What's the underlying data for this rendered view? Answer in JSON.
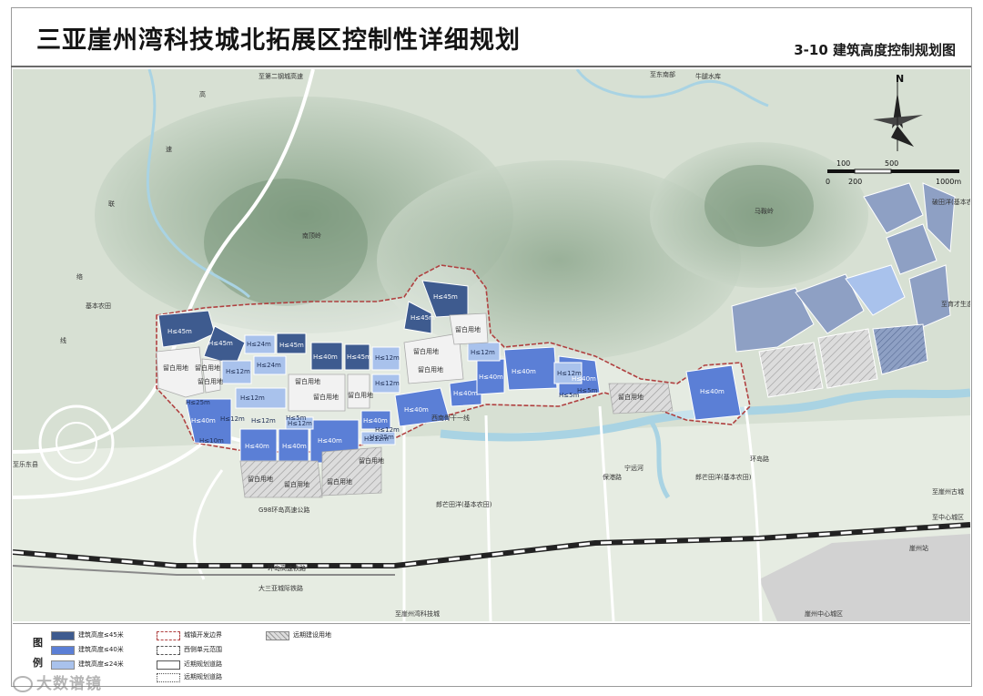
{
  "header": {
    "title": "三亚崖州湾科技城北拓展区控制性详细规划",
    "subtitle": "3-10 建筑高度控制规划图"
  },
  "colors": {
    "h45": "#3e5b8f",
    "h40": "#5b7fd6",
    "h24": "#a9c2ec",
    "reserve": "#f2f2f2",
    "terrain": "#c3d0c0",
    "river": "#a9d3e3",
    "boundary": "#b04040",
    "future": "#c8c8c8"
  },
  "map": {
    "north": "N",
    "scale_labels": [
      "100",
      "500",
      "0",
      "200",
      "1000m"
    ],
    "place_labels": [
      "至第二钢城高速",
      "至东南部",
      "牛腿水库",
      "高",
      "速",
      "联",
      "络",
      "线",
      "南顶岭",
      "马鞍岭",
      "破田洋(基本农田)",
      "至育才生态区",
      "基本农田",
      "至乐东县",
      "G98环岛高速公路",
      "环岛高速铁路",
      "大三亚城际铁路",
      "至崖州湾科技城",
      "崖州中心城区",
      "郎芒田洋(基本农田)",
      "郎芒田洋(基本农田)",
      "宁远河",
      "至崖州古城",
      "至中心城区",
      "保港路",
      "环岛路",
      "西南骨干一线",
      "崖州站"
    ],
    "block_labels": {
      "h45": [
        "H≤45m",
        "H≤45m",
        "H≤45m",
        "H≤40m",
        "H≤45m",
        "H≤45m",
        "H≤45m"
      ],
      "h40": [
        "H≤40m",
        "H≤40m",
        "H≤40m",
        "H≤40m",
        "H≤40m",
        "H≤40m",
        "H≤40m",
        "H≤40m",
        "H≤40m",
        "H≤40m",
        "H≤40m"
      ],
      "h24": [
        "H≤24m",
        "H≤12m",
        "H≤24m",
        "H≤12m",
        "H≤12m",
        "H≤12m",
        "H≤12m",
        "H≤12m",
        "H≤12m",
        "H≤5m",
        "H≤10m",
        "H≤25m",
        "H≤12m",
        "H≤12m",
        "H≤12m",
        "H≤12m",
        "H≤5m",
        "H≤25m",
        "H≤5m"
      ],
      "reserve": [
        "留白用地",
        "留白用地",
        "留白用地",
        "留白用地",
        "留白用地",
        "留白用地",
        "留白用地",
        "留白用地",
        "留白用地",
        "留白用地",
        "留白用地",
        "留白用地",
        "留白用地",
        "留白用地"
      ]
    }
  },
  "legend": {
    "title": "图例",
    "items": [
      "建筑高度≤45米",
      "建筑高度≤40米",
      "建筑高度≤24米",
      "城镇开发边界",
      "西侧单元范围",
      "近期规划道路",
      "远期规划道路",
      "远期建设用地"
    ]
  },
  "watermark": "大数谱镜"
}
